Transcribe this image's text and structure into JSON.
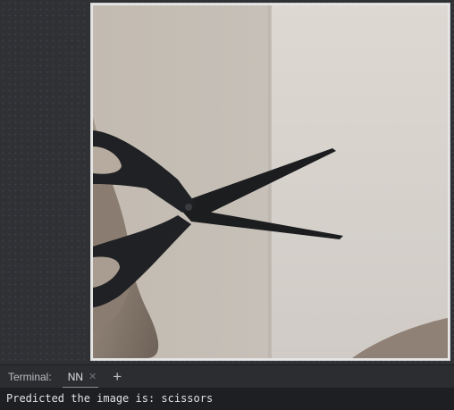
{
  "terminal": {
    "label": "Terminal:",
    "tabs": [
      {
        "label": "NN",
        "close_icon": "close-icon"
      }
    ],
    "new_tab_symbol": "+",
    "output": "Predicted the image is: scissors"
  },
  "viewer": {
    "image_subject": "scissors photo"
  }
}
